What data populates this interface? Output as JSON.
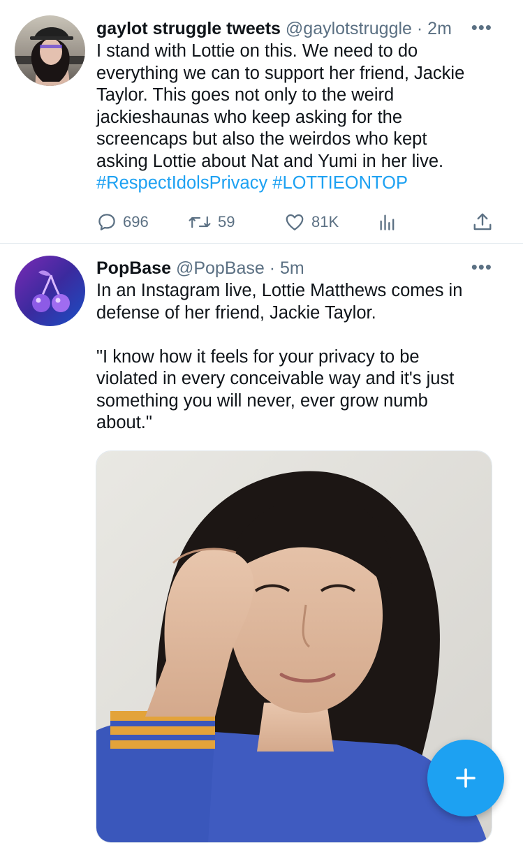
{
  "feed": {
    "tweets": [
      {
        "display_name": "gaylot struggle tweets",
        "handle": "@gaylotstruggle",
        "separator": "·",
        "time": "2m",
        "text_lines": [
          "I stand with Lottie on this. We need to do",
          "everything we can to support her friend, Jackie",
          "Taylor. This goes not only to the weird",
          "jackieshaunas who keep asking for the",
          "screencaps but also the weirdos who kept",
          "asking Lottie about Nat and Yumi in her live."
        ],
        "hashtags": [
          "#RespectIdolsPrivacy",
          "#LOTTIEONTOP"
        ],
        "replies": "696",
        "retweets": "59",
        "likes": "81K"
      },
      {
        "display_name": "PopBase",
        "handle": "@PopBase",
        "separator": "·",
        "time": "5m",
        "text_lines": [
          "In an Instagram live, Lottie Matthews comes in",
          "defense of her friend, Jackie Taylor.",
          "",
          "\"I know how it feels for your privacy to be",
          "violated in every conceivable way and it's just",
          "something you will never, ever grow numb",
          "about.\""
        ]
      }
    ]
  },
  "icons": {
    "more": "more-horizontal-icon",
    "reply": "reply-bubble-icon",
    "retweet": "retweet-arrows-icon",
    "like": "heart-icon",
    "analytics": "bar-chart-icon",
    "share": "share-upload-icon",
    "compose": "plus-icon",
    "popbase_avatar": "cherry-icon"
  },
  "colors": {
    "accent": "#1da1f2",
    "secondary_text": "#5b7083",
    "primary_text": "#0f1419",
    "divider": "#e6ecf0"
  }
}
